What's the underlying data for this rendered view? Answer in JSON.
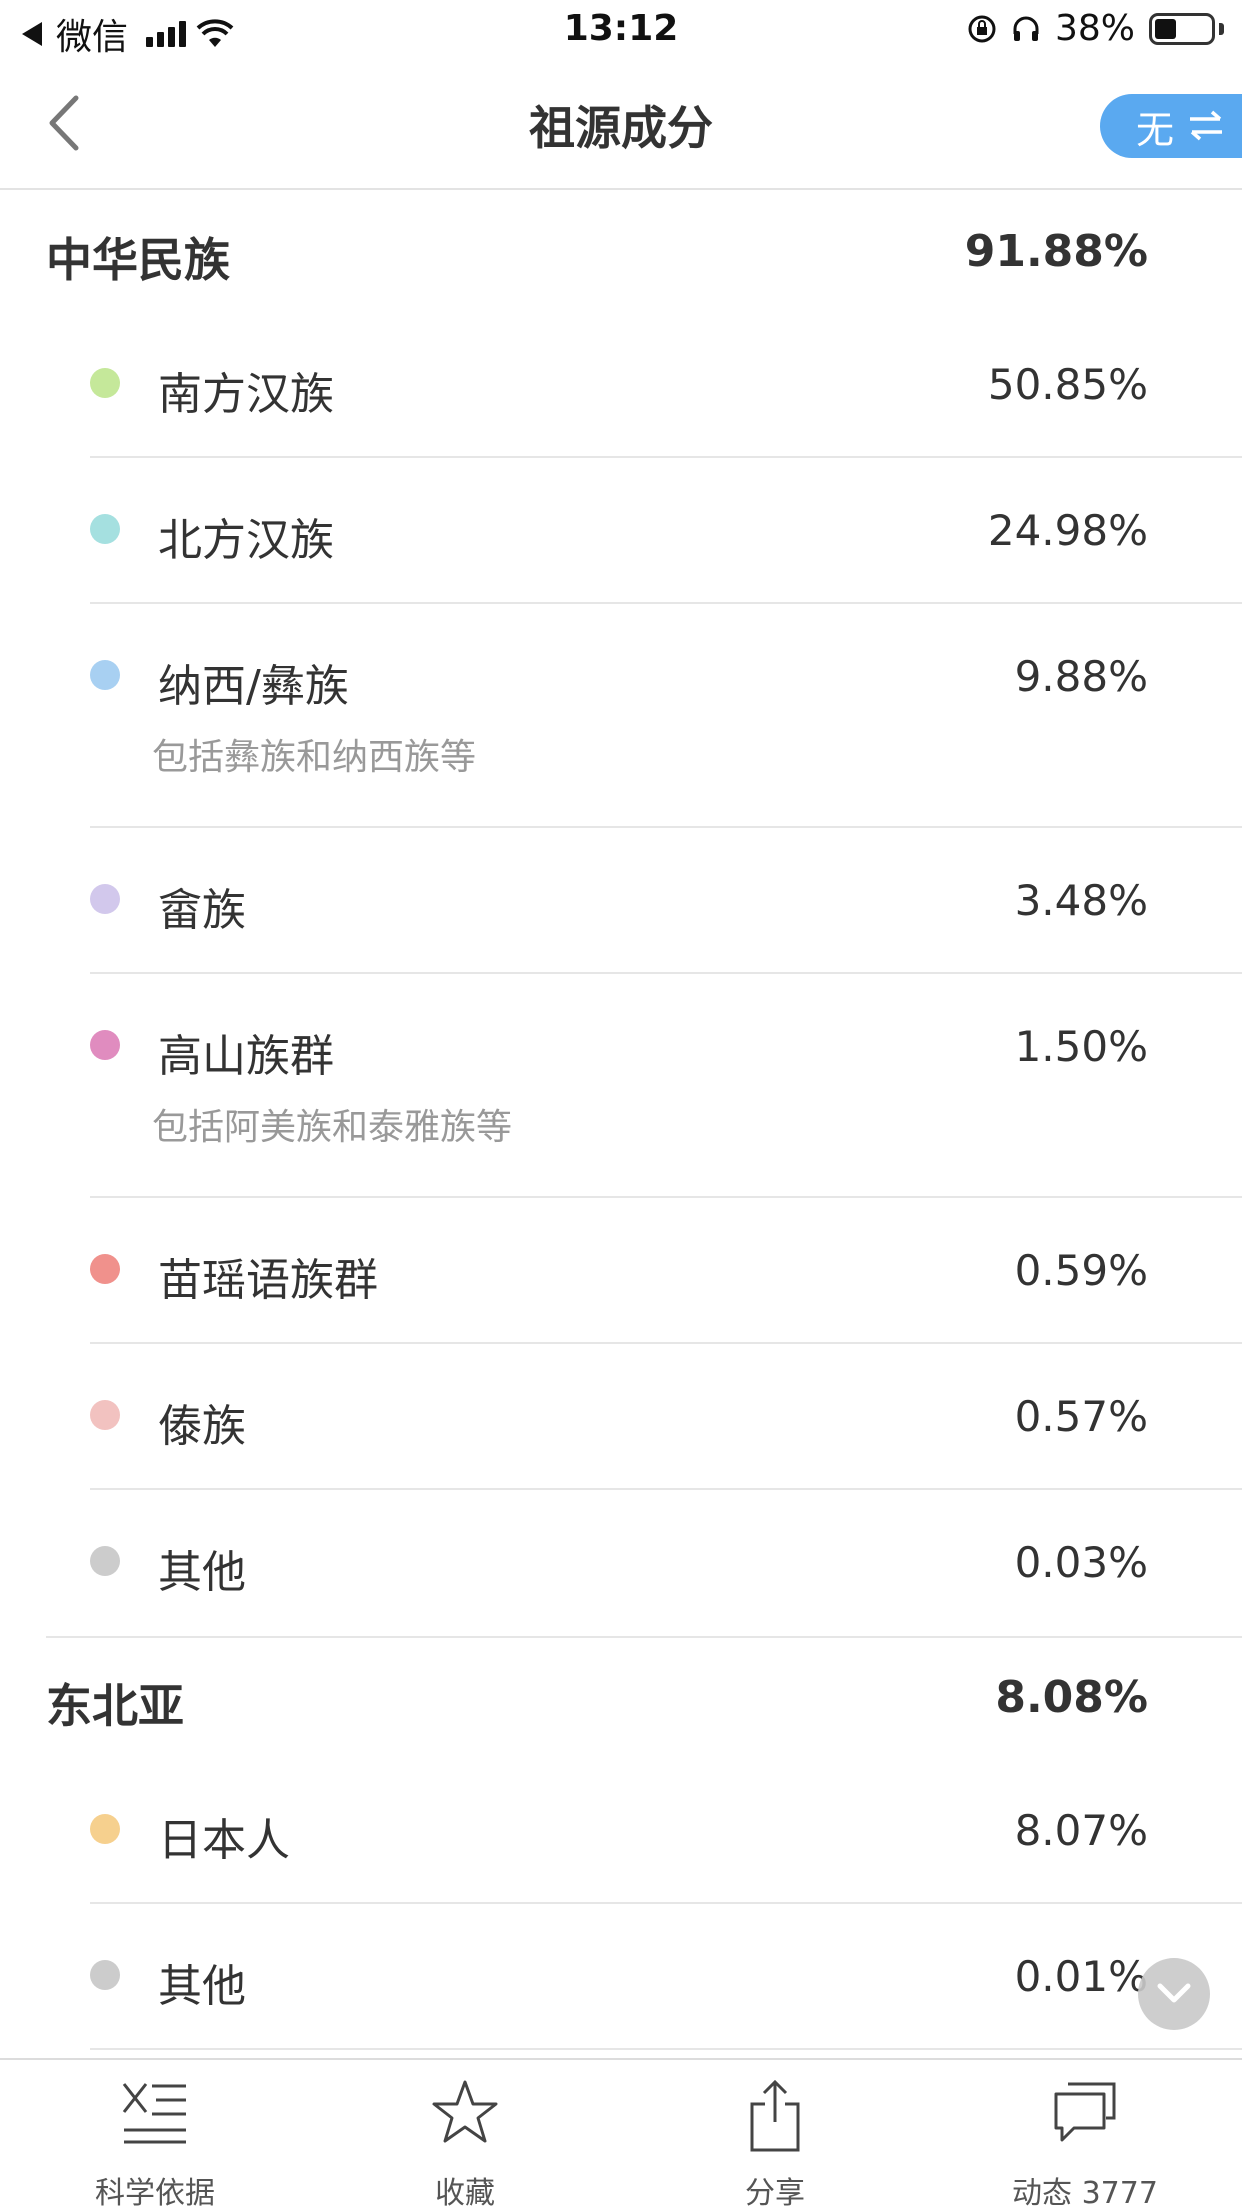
{
  "status_bar": {
    "carrier": "微信",
    "time": "13:12",
    "battery_percent": "38%",
    "battery_level": 0.38
  },
  "nav": {
    "title": "祖源成分",
    "switch_label": "无",
    "icons": {
      "back": "chevron-left-icon",
      "switch": "swap-arrows-icon"
    }
  },
  "groups": [
    {
      "name": "中华民族",
      "percent": "91.88%",
      "items": [
        {
          "name": "南方汉族",
          "percent": "50.85%",
          "color": "#c5e89a"
        },
        {
          "name": "北方汉族",
          "percent": "24.98%",
          "color": "#a5e0e0"
        },
        {
          "name": "纳西/彝族",
          "percent": "9.88%",
          "color": "#a8d0f2",
          "note": "包括彝族和纳西族等"
        },
        {
          "name": "畲族",
          "percent": "3.48%",
          "color": "#d2c8ec"
        },
        {
          "name": "高山族群",
          "percent": "1.50%",
          "color": "#e08cbf",
          "note": "包括阿美族和泰雅族等"
        },
        {
          "name": "苗瑶语族群",
          "percent": "0.59%",
          "color": "#f0918c"
        },
        {
          "name": "傣族",
          "percent": "0.57%",
          "color": "#f2c2c0"
        },
        {
          "name": "其他",
          "percent": "0.03%",
          "color": "#cccccc"
        }
      ]
    },
    {
      "name": "东北亚",
      "percent": "8.08%",
      "items": [
        {
          "name": "日本人",
          "percent": "8.07%",
          "color": "#f6d08e"
        },
        {
          "name": "其他",
          "percent": "0.01%",
          "color": "#cccccc"
        }
      ]
    }
  ],
  "tab_bar": {
    "tabs": [
      {
        "label": "科学依据",
        "icon": "science-basis-icon"
      },
      {
        "label": "收藏",
        "icon": "star-icon"
      },
      {
        "label": "分享",
        "icon": "share-icon"
      },
      {
        "label": "动态 3777",
        "icon": "chat-bubbles-icon"
      }
    ]
  }
}
